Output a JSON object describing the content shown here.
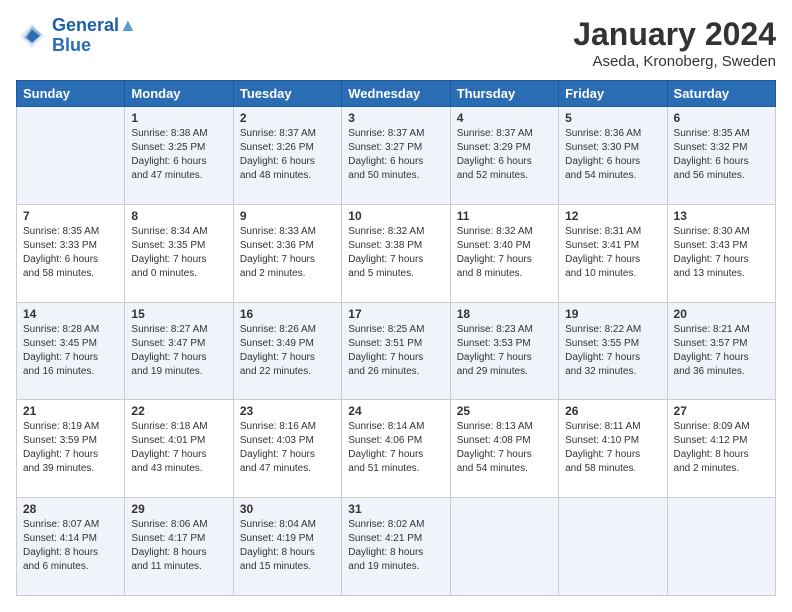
{
  "header": {
    "logo_line1": "General",
    "logo_line2": "Blue",
    "month_title": "January 2024",
    "location": "Aseda, Kronoberg, Sweden"
  },
  "days_of_week": [
    "Sunday",
    "Monday",
    "Tuesday",
    "Wednesday",
    "Thursday",
    "Friday",
    "Saturday"
  ],
  "weeks": [
    [
      {
        "day": "",
        "info": ""
      },
      {
        "day": "1",
        "info": "Sunrise: 8:38 AM\nSunset: 3:25 PM\nDaylight: 6 hours\nand 47 minutes."
      },
      {
        "day": "2",
        "info": "Sunrise: 8:37 AM\nSunset: 3:26 PM\nDaylight: 6 hours\nand 48 minutes."
      },
      {
        "day": "3",
        "info": "Sunrise: 8:37 AM\nSunset: 3:27 PM\nDaylight: 6 hours\nand 50 minutes."
      },
      {
        "day": "4",
        "info": "Sunrise: 8:37 AM\nSunset: 3:29 PM\nDaylight: 6 hours\nand 52 minutes."
      },
      {
        "day": "5",
        "info": "Sunrise: 8:36 AM\nSunset: 3:30 PM\nDaylight: 6 hours\nand 54 minutes."
      },
      {
        "day": "6",
        "info": "Sunrise: 8:35 AM\nSunset: 3:32 PM\nDaylight: 6 hours\nand 56 minutes."
      }
    ],
    [
      {
        "day": "7",
        "info": "Sunrise: 8:35 AM\nSunset: 3:33 PM\nDaylight: 6 hours\nand 58 minutes."
      },
      {
        "day": "8",
        "info": "Sunrise: 8:34 AM\nSunset: 3:35 PM\nDaylight: 7 hours\nand 0 minutes."
      },
      {
        "day": "9",
        "info": "Sunrise: 8:33 AM\nSunset: 3:36 PM\nDaylight: 7 hours\nand 2 minutes."
      },
      {
        "day": "10",
        "info": "Sunrise: 8:32 AM\nSunset: 3:38 PM\nDaylight: 7 hours\nand 5 minutes."
      },
      {
        "day": "11",
        "info": "Sunrise: 8:32 AM\nSunset: 3:40 PM\nDaylight: 7 hours\nand 8 minutes."
      },
      {
        "day": "12",
        "info": "Sunrise: 8:31 AM\nSunset: 3:41 PM\nDaylight: 7 hours\nand 10 minutes."
      },
      {
        "day": "13",
        "info": "Sunrise: 8:30 AM\nSunset: 3:43 PM\nDaylight: 7 hours\nand 13 minutes."
      }
    ],
    [
      {
        "day": "14",
        "info": "Sunrise: 8:28 AM\nSunset: 3:45 PM\nDaylight: 7 hours\nand 16 minutes."
      },
      {
        "day": "15",
        "info": "Sunrise: 8:27 AM\nSunset: 3:47 PM\nDaylight: 7 hours\nand 19 minutes."
      },
      {
        "day": "16",
        "info": "Sunrise: 8:26 AM\nSunset: 3:49 PM\nDaylight: 7 hours\nand 22 minutes."
      },
      {
        "day": "17",
        "info": "Sunrise: 8:25 AM\nSunset: 3:51 PM\nDaylight: 7 hours\nand 26 minutes."
      },
      {
        "day": "18",
        "info": "Sunrise: 8:23 AM\nSunset: 3:53 PM\nDaylight: 7 hours\nand 29 minutes."
      },
      {
        "day": "19",
        "info": "Sunrise: 8:22 AM\nSunset: 3:55 PM\nDaylight: 7 hours\nand 32 minutes."
      },
      {
        "day": "20",
        "info": "Sunrise: 8:21 AM\nSunset: 3:57 PM\nDaylight: 7 hours\nand 36 minutes."
      }
    ],
    [
      {
        "day": "21",
        "info": "Sunrise: 8:19 AM\nSunset: 3:59 PM\nDaylight: 7 hours\nand 39 minutes."
      },
      {
        "day": "22",
        "info": "Sunrise: 8:18 AM\nSunset: 4:01 PM\nDaylight: 7 hours\nand 43 minutes."
      },
      {
        "day": "23",
        "info": "Sunrise: 8:16 AM\nSunset: 4:03 PM\nDaylight: 7 hours\nand 47 minutes."
      },
      {
        "day": "24",
        "info": "Sunrise: 8:14 AM\nSunset: 4:06 PM\nDaylight: 7 hours\nand 51 minutes."
      },
      {
        "day": "25",
        "info": "Sunrise: 8:13 AM\nSunset: 4:08 PM\nDaylight: 7 hours\nand 54 minutes."
      },
      {
        "day": "26",
        "info": "Sunrise: 8:11 AM\nSunset: 4:10 PM\nDaylight: 7 hours\nand 58 minutes."
      },
      {
        "day": "27",
        "info": "Sunrise: 8:09 AM\nSunset: 4:12 PM\nDaylight: 8 hours\nand 2 minutes."
      }
    ],
    [
      {
        "day": "28",
        "info": "Sunrise: 8:07 AM\nSunset: 4:14 PM\nDaylight: 8 hours\nand 6 minutes."
      },
      {
        "day": "29",
        "info": "Sunrise: 8:06 AM\nSunset: 4:17 PM\nDaylight: 8 hours\nand 11 minutes."
      },
      {
        "day": "30",
        "info": "Sunrise: 8:04 AM\nSunset: 4:19 PM\nDaylight: 8 hours\nand 15 minutes."
      },
      {
        "day": "31",
        "info": "Sunrise: 8:02 AM\nSunset: 4:21 PM\nDaylight: 8 hours\nand 19 minutes."
      },
      {
        "day": "",
        "info": ""
      },
      {
        "day": "",
        "info": ""
      },
      {
        "day": "",
        "info": ""
      }
    ]
  ]
}
